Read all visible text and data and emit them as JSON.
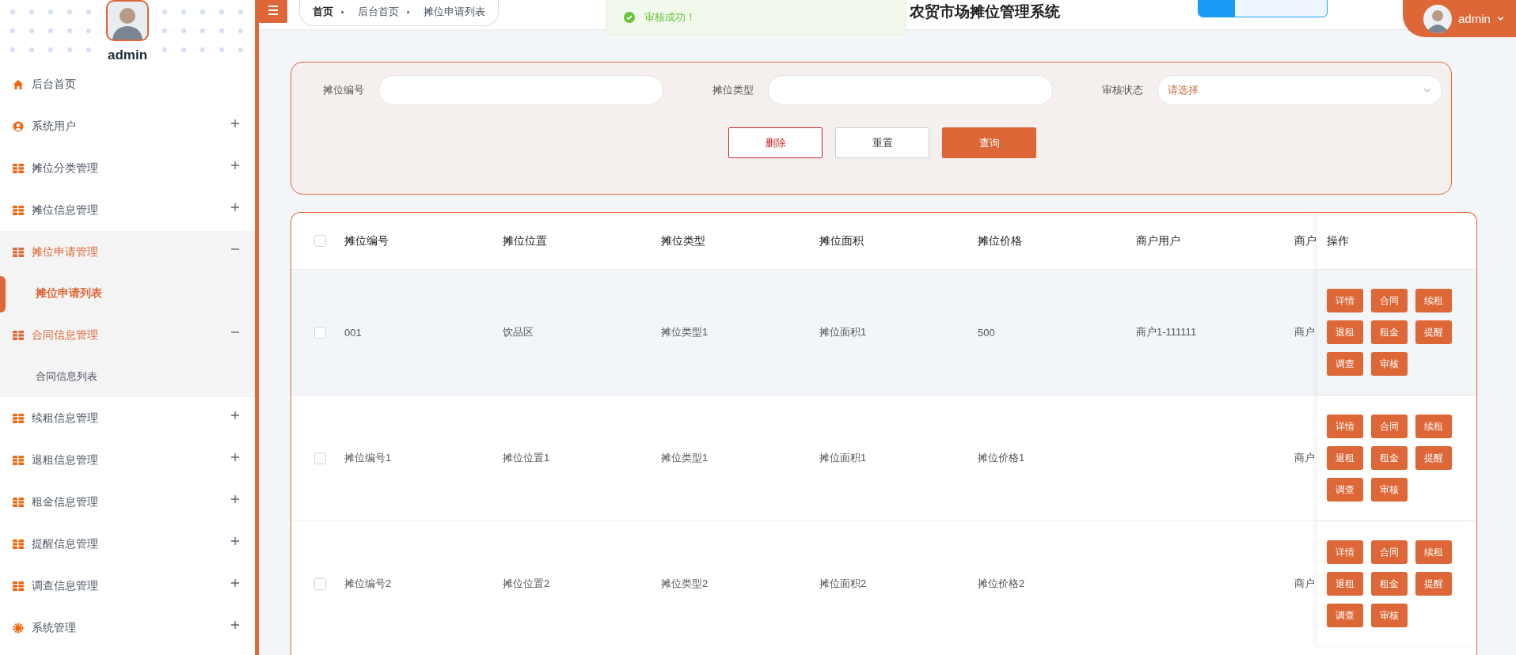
{
  "sidebar": {
    "user": {
      "name": "admin"
    },
    "items": [
      {
        "label": "后台首页",
        "expandable": false,
        "expanded": false
      },
      {
        "label": "系统用户",
        "expandable": true,
        "expanded": false
      },
      {
        "label": "摊位分类管理",
        "expandable": true,
        "expanded": false
      },
      {
        "label": "摊位信息管理",
        "expandable": true,
        "expanded": false
      },
      {
        "label": "摊位申请管理",
        "expandable": true,
        "expanded": true,
        "children": [
          {
            "label": "摊位申请列表",
            "selected": true
          }
        ]
      },
      {
        "label": "合同信息管理",
        "expandable": true,
        "expanded": true,
        "children": [
          {
            "label": "合同信息列表",
            "selected": false
          }
        ]
      },
      {
        "label": "续租信息管理",
        "expandable": true,
        "expanded": false
      },
      {
        "label": "退租信息管理",
        "expandable": true,
        "expanded": false
      },
      {
        "label": "租金信息管理",
        "expandable": true,
        "expanded": false
      },
      {
        "label": "提醒信息管理",
        "expandable": true,
        "expanded": false
      },
      {
        "label": "调查信息管理",
        "expandable": true,
        "expanded": false
      },
      {
        "label": "系统管理",
        "expandable": true,
        "expanded": false
      }
    ]
  },
  "header": {
    "breadcrumb": [
      {
        "label": "首页",
        "kind": "root"
      },
      {
        "label": "后台首页",
        "kind": "link"
      },
      {
        "label": "摊位申请列表",
        "kind": "link"
      }
    ],
    "toast": {
      "message": "审核成功！"
    },
    "title": "农贸市场摊位管理系统",
    "user_menu": {
      "name": "admin"
    }
  },
  "search_form": {
    "fields": [
      {
        "label": "摊位编号",
        "kind": "input"
      },
      {
        "label": "摊位类型",
        "kind": "input"
      },
      {
        "label": "审核状态",
        "kind": "select",
        "placeholder": "请选择"
      }
    ],
    "buttons": [
      {
        "label": "删除",
        "kind": "danger"
      },
      {
        "label": "重置",
        "kind": "plain"
      },
      {
        "label": "查询",
        "kind": "primary"
      }
    ]
  },
  "table": {
    "all_checked": false,
    "columns": [
      "摊位编号",
      "摊位位置",
      "摊位类型",
      "摊位面积",
      "摊位价格",
      "商户用户",
      "商户"
    ],
    "action_column": "操作",
    "rows": [
      {
        "checked": false,
        "highlighted": true,
        "cells": [
          "001",
          "饮品区",
          "摊位类型1",
          "摊位面积1",
          "500",
          "商户1-111111",
          "商户"
        ],
        "actions": [
          "详情",
          "合同",
          "续租",
          "退租",
          "租金",
          "提醒",
          "调查",
          "审核"
        ]
      },
      {
        "checked": false,
        "highlighted": false,
        "cells": [
          "摊位编号1",
          "摊位位置1",
          "摊位类型1",
          "摊位面积1",
          "摊位价格1",
          null,
          "商户"
        ],
        "actions": [
          "详情",
          "合同",
          "续租",
          "退租",
          "租金",
          "提醒",
          "调查",
          "审核"
        ]
      },
      {
        "checked": false,
        "highlighted": false,
        "cells": [
          "摊位编号2",
          "摊位位置2",
          "摊位类型2",
          "摊位面积2",
          "摊位价格2",
          null,
          "商户"
        ],
        "actions": [
          "详情",
          "合同",
          "续租",
          "退租",
          "租金",
          "提醒",
          "调查",
          "审核"
        ]
      }
    ]
  }
}
